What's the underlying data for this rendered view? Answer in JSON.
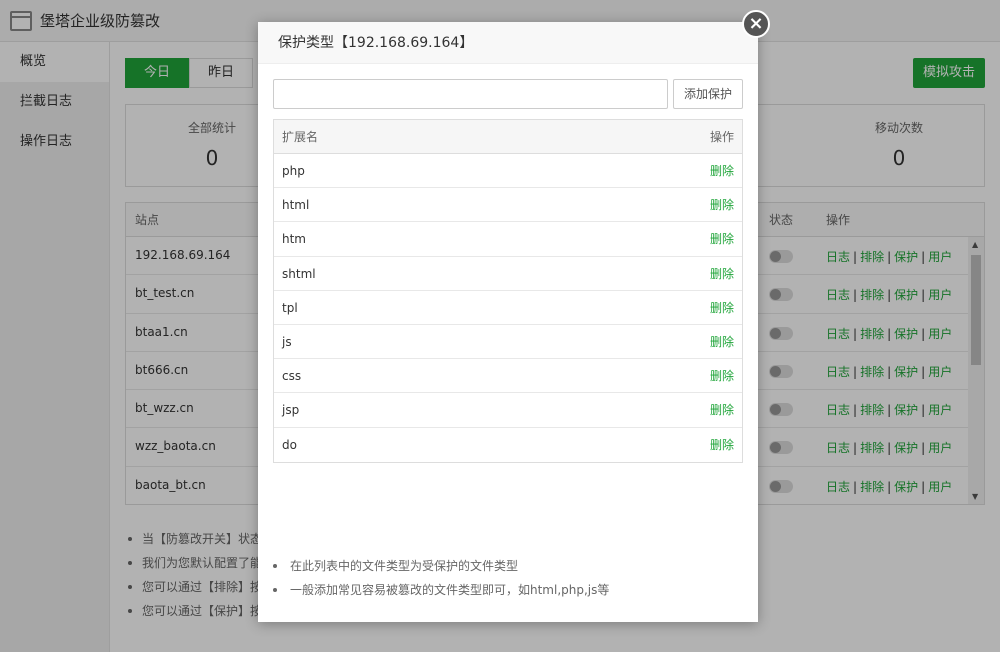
{
  "app": {
    "title": "堡塔企业级防篡改"
  },
  "sidebar": {
    "items": [
      {
        "label": "概览"
      },
      {
        "label": "拦截日志"
      },
      {
        "label": "操作日志"
      }
    ]
  },
  "main": {
    "tabs": [
      {
        "label": "今日"
      },
      {
        "label": "昨日"
      }
    ],
    "simulate_button": "模拟攻击",
    "stats": [
      {
        "label": "全部统计",
        "value": "0"
      },
      {
        "label": "移动次数",
        "value": "0"
      }
    ],
    "table": {
      "headers": {
        "site": "站点",
        "status": "状态",
        "ops": "操作"
      },
      "rows": [
        {
          "site": "192.168.69.164"
        },
        {
          "site": "bt_test.cn"
        },
        {
          "site": "btaa1.cn"
        },
        {
          "site": "bt666.cn"
        },
        {
          "site": "bt_wzz.cn"
        },
        {
          "site": "wzz_baota.cn"
        },
        {
          "site": "baota_bt.cn"
        }
      ],
      "ops": {
        "log": "日志",
        "exclude": "排除",
        "protect": "保护",
        "user": "用户",
        "separator": "|"
      }
    },
    "notes": [
      "当【防篡改开关】状态",
      "我们为您默认配置了能",
      "您可以通过【排除】按",
      "您可以通过【保护】按"
    ]
  },
  "modal": {
    "title": "保护类型【192.168.69.164】",
    "close_symbol": "×",
    "input_value": "",
    "add_button": "添加保护",
    "table": {
      "headers": {
        "name": "扩展名",
        "op": "操作"
      },
      "rows": [
        {
          "name": "php",
          "op": "删除"
        },
        {
          "name": "html",
          "op": "删除"
        },
        {
          "name": "htm",
          "op": "删除"
        },
        {
          "name": "shtml",
          "op": "删除"
        },
        {
          "name": "tpl",
          "op": "删除"
        },
        {
          "name": "js",
          "op": "删除"
        },
        {
          "name": "css",
          "op": "删除"
        },
        {
          "name": "jsp",
          "op": "删除"
        },
        {
          "name": "do",
          "op": "删除"
        }
      ]
    },
    "notes": [
      "在此列表中的文件类型为受保护的文件类型",
      "一般添加常见容易被篡改的文件类型即可，如html,php,js等"
    ]
  },
  "colors": {
    "accent": "#20a53a",
    "overlay": "rgba(0,0,0,0.3)"
  }
}
